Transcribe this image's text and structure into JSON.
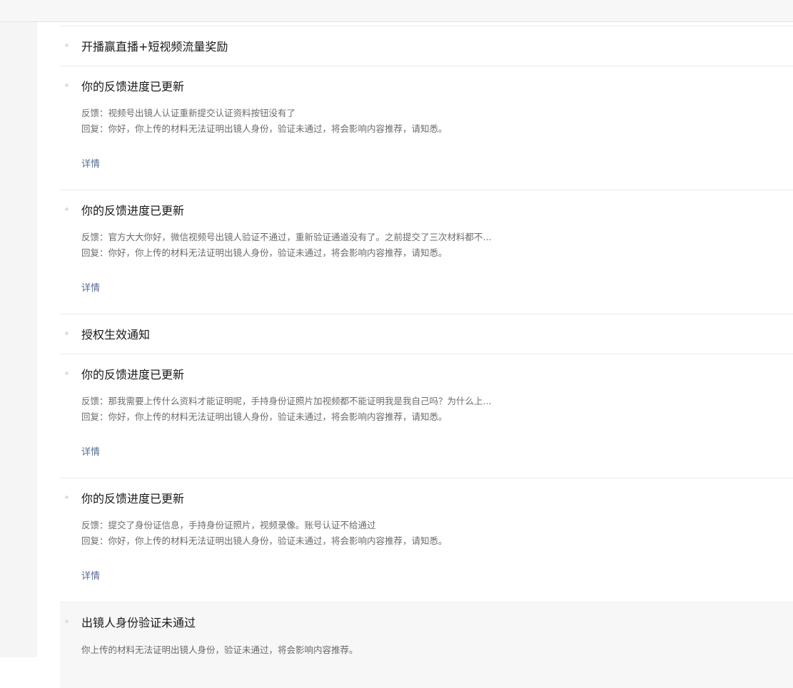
{
  "notifications": [
    {
      "type": "simple",
      "title": "开播赢直播+短视频流量奖励"
    },
    {
      "type": "feedback",
      "title": "你的反馈进度已更新",
      "feedback": "反馈：视频号出镜人认证重新提交认证资料按钮没有了",
      "reply": "回复：你好，你上传的材料无法证明出镜人身份，验证未通过，将会影响内容推荐，请知悉。",
      "detail_label": "详情"
    },
    {
      "type": "feedback",
      "title": "你的反馈进度已更新",
      "feedback": "反馈：官方大大你好，微信视频号出镜人验证不通过，重新验证通道没有了。之前提交了三次材料都不...",
      "reply": "回复：你好，你上传的材料无法证明出镜人身份，验证未通过，将会影响内容推荐，请知悉。",
      "detail_label": "详情"
    },
    {
      "type": "simple",
      "title": "授权生效通知"
    },
    {
      "type": "feedback",
      "title": "你的反馈进度已更新",
      "feedback": "反馈：那我需要上传什么资料才能证明呢，手持身份证照片加视频都不能证明我是我自己吗？为什么上...",
      "reply": "回复：你好，你上传的材料无法证明出镜人身份，验证未通过，将会影响内容推荐，请知悉。",
      "detail_label": "详情"
    },
    {
      "type": "feedback",
      "title": "你的反馈进度已更新",
      "feedback": "反馈：提交了身份证信息，手持身份证照片，视频录像。账号认证不给通过",
      "reply": "回复：你好，你上传的材料无法证明出镜人身份，验证未通过，将会影响内容推荐，请知悉。",
      "detail_label": "详情"
    },
    {
      "type": "final",
      "title": "出镜人身份验证未通过",
      "description": "你上传的材料无法证明出镜人身份，验证未通过，将会影响内容推荐。"
    }
  ],
  "colors": {
    "link": "#576b95",
    "title": "#191919",
    "body": "#6b6b6b",
    "divider": "#ececec"
  }
}
